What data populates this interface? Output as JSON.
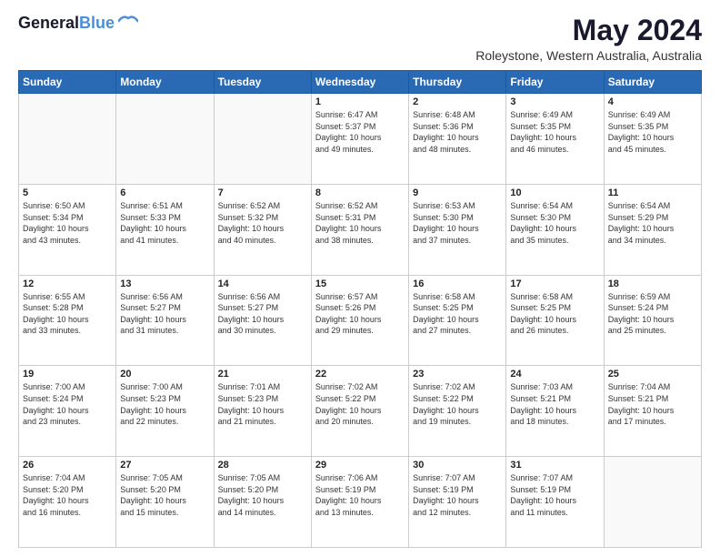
{
  "header": {
    "logo_line1": "General",
    "logo_line2": "Blue",
    "month": "May 2024",
    "location": "Roleystone, Western Australia, Australia"
  },
  "days_of_week": [
    "Sunday",
    "Monday",
    "Tuesday",
    "Wednesday",
    "Thursday",
    "Friday",
    "Saturday"
  ],
  "weeks": [
    [
      {
        "day": "",
        "content": ""
      },
      {
        "day": "",
        "content": ""
      },
      {
        "day": "",
        "content": ""
      },
      {
        "day": "1",
        "content": "Sunrise: 6:47 AM\nSunset: 5:37 PM\nDaylight: 10 hours\nand 49 minutes."
      },
      {
        "day": "2",
        "content": "Sunrise: 6:48 AM\nSunset: 5:36 PM\nDaylight: 10 hours\nand 48 minutes."
      },
      {
        "day": "3",
        "content": "Sunrise: 6:49 AM\nSunset: 5:35 PM\nDaylight: 10 hours\nand 46 minutes."
      },
      {
        "day": "4",
        "content": "Sunrise: 6:49 AM\nSunset: 5:35 PM\nDaylight: 10 hours\nand 45 minutes."
      }
    ],
    [
      {
        "day": "5",
        "content": "Sunrise: 6:50 AM\nSunset: 5:34 PM\nDaylight: 10 hours\nand 43 minutes."
      },
      {
        "day": "6",
        "content": "Sunrise: 6:51 AM\nSunset: 5:33 PM\nDaylight: 10 hours\nand 41 minutes."
      },
      {
        "day": "7",
        "content": "Sunrise: 6:52 AM\nSunset: 5:32 PM\nDaylight: 10 hours\nand 40 minutes."
      },
      {
        "day": "8",
        "content": "Sunrise: 6:52 AM\nSunset: 5:31 PM\nDaylight: 10 hours\nand 38 minutes."
      },
      {
        "day": "9",
        "content": "Sunrise: 6:53 AM\nSunset: 5:30 PM\nDaylight: 10 hours\nand 37 minutes."
      },
      {
        "day": "10",
        "content": "Sunrise: 6:54 AM\nSunset: 5:30 PM\nDaylight: 10 hours\nand 35 minutes."
      },
      {
        "day": "11",
        "content": "Sunrise: 6:54 AM\nSunset: 5:29 PM\nDaylight: 10 hours\nand 34 minutes."
      }
    ],
    [
      {
        "day": "12",
        "content": "Sunrise: 6:55 AM\nSunset: 5:28 PM\nDaylight: 10 hours\nand 33 minutes."
      },
      {
        "day": "13",
        "content": "Sunrise: 6:56 AM\nSunset: 5:27 PM\nDaylight: 10 hours\nand 31 minutes."
      },
      {
        "day": "14",
        "content": "Sunrise: 6:56 AM\nSunset: 5:27 PM\nDaylight: 10 hours\nand 30 minutes."
      },
      {
        "day": "15",
        "content": "Sunrise: 6:57 AM\nSunset: 5:26 PM\nDaylight: 10 hours\nand 29 minutes."
      },
      {
        "day": "16",
        "content": "Sunrise: 6:58 AM\nSunset: 5:25 PM\nDaylight: 10 hours\nand 27 minutes."
      },
      {
        "day": "17",
        "content": "Sunrise: 6:58 AM\nSunset: 5:25 PM\nDaylight: 10 hours\nand 26 minutes."
      },
      {
        "day": "18",
        "content": "Sunrise: 6:59 AM\nSunset: 5:24 PM\nDaylight: 10 hours\nand 25 minutes."
      }
    ],
    [
      {
        "day": "19",
        "content": "Sunrise: 7:00 AM\nSunset: 5:24 PM\nDaylight: 10 hours\nand 23 minutes."
      },
      {
        "day": "20",
        "content": "Sunrise: 7:00 AM\nSunset: 5:23 PM\nDaylight: 10 hours\nand 22 minutes."
      },
      {
        "day": "21",
        "content": "Sunrise: 7:01 AM\nSunset: 5:23 PM\nDaylight: 10 hours\nand 21 minutes."
      },
      {
        "day": "22",
        "content": "Sunrise: 7:02 AM\nSunset: 5:22 PM\nDaylight: 10 hours\nand 20 minutes."
      },
      {
        "day": "23",
        "content": "Sunrise: 7:02 AM\nSunset: 5:22 PM\nDaylight: 10 hours\nand 19 minutes."
      },
      {
        "day": "24",
        "content": "Sunrise: 7:03 AM\nSunset: 5:21 PM\nDaylight: 10 hours\nand 18 minutes."
      },
      {
        "day": "25",
        "content": "Sunrise: 7:04 AM\nSunset: 5:21 PM\nDaylight: 10 hours\nand 17 minutes."
      }
    ],
    [
      {
        "day": "26",
        "content": "Sunrise: 7:04 AM\nSunset: 5:20 PM\nDaylight: 10 hours\nand 16 minutes."
      },
      {
        "day": "27",
        "content": "Sunrise: 7:05 AM\nSunset: 5:20 PM\nDaylight: 10 hours\nand 15 minutes."
      },
      {
        "day": "28",
        "content": "Sunrise: 7:05 AM\nSunset: 5:20 PM\nDaylight: 10 hours\nand 14 minutes."
      },
      {
        "day": "29",
        "content": "Sunrise: 7:06 AM\nSunset: 5:19 PM\nDaylight: 10 hours\nand 13 minutes."
      },
      {
        "day": "30",
        "content": "Sunrise: 7:07 AM\nSunset: 5:19 PM\nDaylight: 10 hours\nand 12 minutes."
      },
      {
        "day": "31",
        "content": "Sunrise: 7:07 AM\nSunset: 5:19 PM\nDaylight: 10 hours\nand 11 minutes."
      },
      {
        "day": "",
        "content": ""
      }
    ]
  ]
}
